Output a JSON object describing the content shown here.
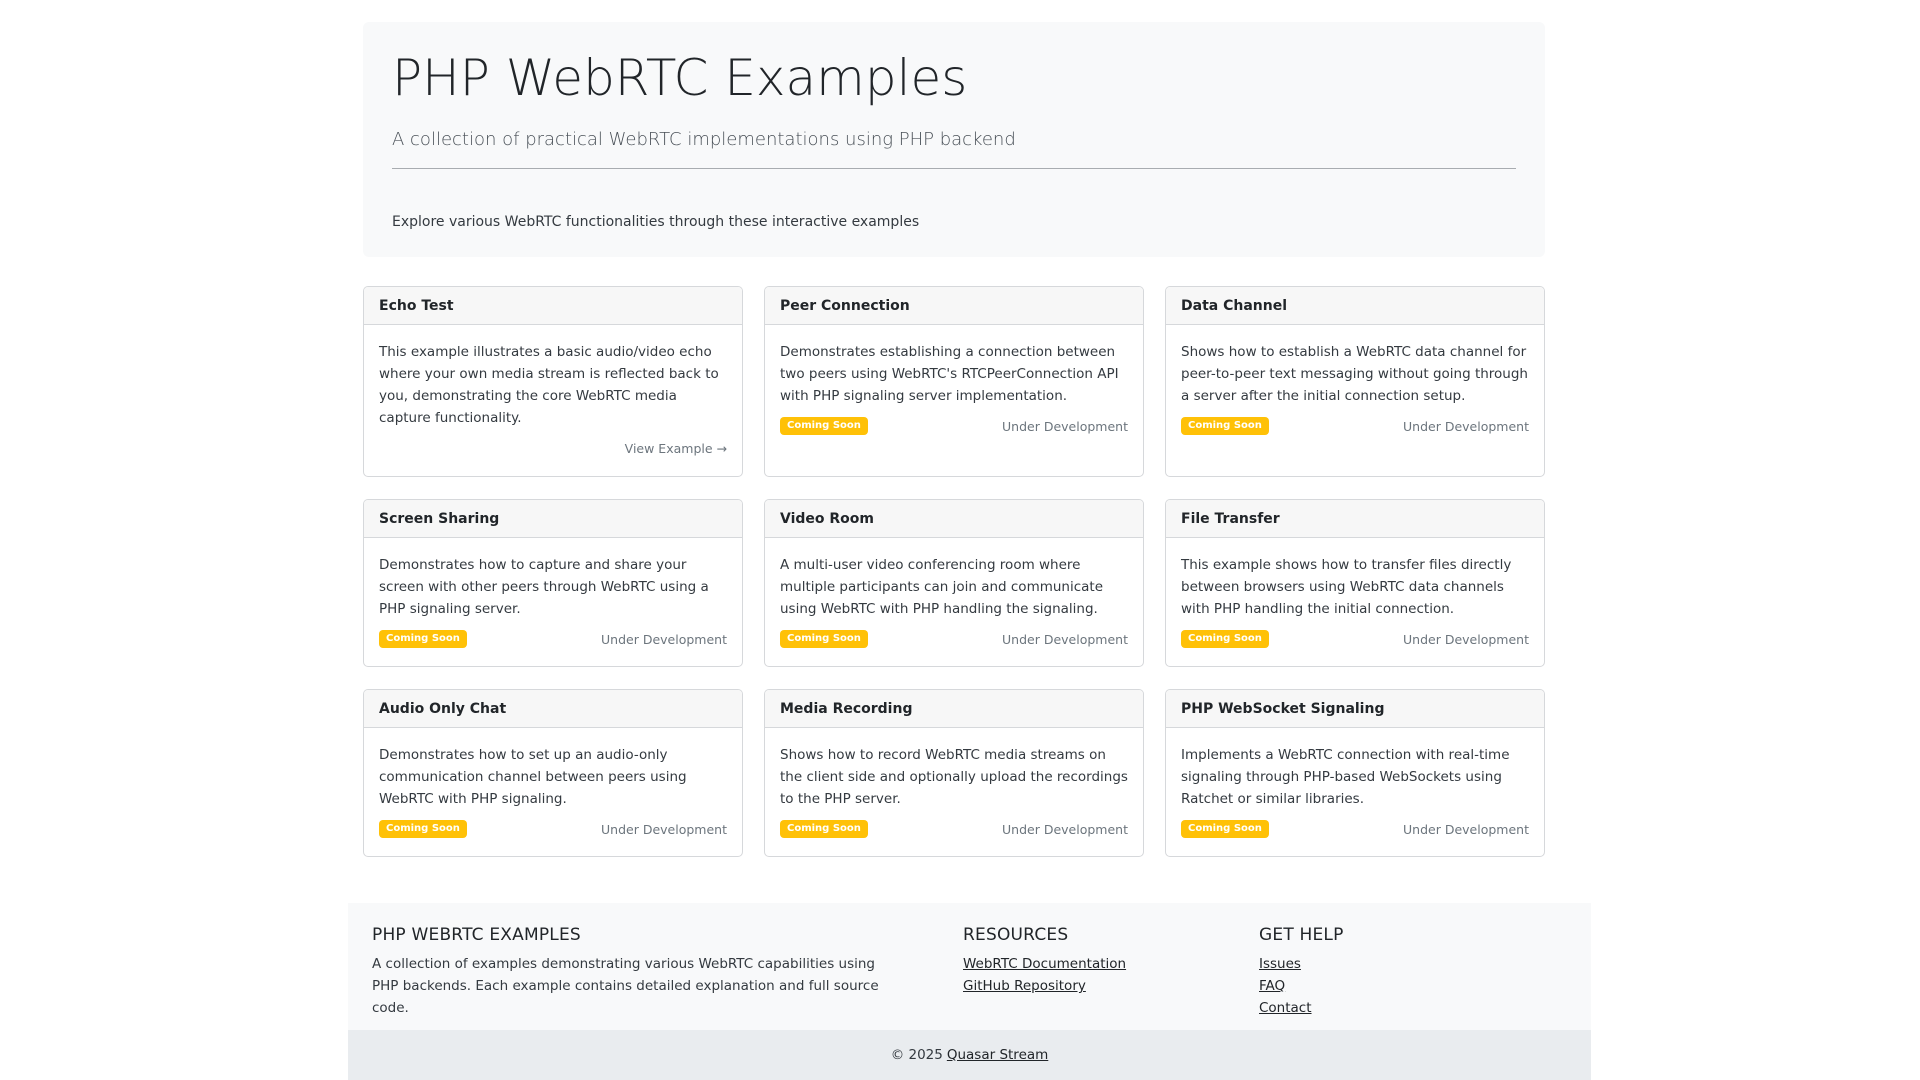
{
  "hero": {
    "title": "PHP WebRTC Examples",
    "lead": "A collection of practical WebRTC implementations using PHP backend",
    "explore": "Explore various WebRTC functionalities through these interactive examples"
  },
  "cards": [
    {
      "title": "Echo Test",
      "text": "This example illustrates a basic audio/video echo where your own media stream is reflected back to you, demonstrating the core WebRTC media capture functionality.",
      "link": "View Example →"
    },
    {
      "title": "Peer Connection",
      "text": "Demonstrates establishing a connection between two peers using WebRTC's RTCPeerConnection API with PHP signaling server implementation.",
      "badge": "Coming Soon",
      "status": "Under Development"
    },
    {
      "title": "Data Channel",
      "text": "Shows how to establish a WebRTC data channel for peer-to-peer text messaging without going through a server after the initial connection setup.",
      "badge": "Coming Soon",
      "status": "Under Development"
    },
    {
      "title": "Screen Sharing",
      "text": "Demonstrates how to capture and share your screen with other peers through WebRTC using a PHP signaling server.",
      "badge": "Coming Soon",
      "status": "Under Development"
    },
    {
      "title": "Video Room",
      "text": "A multi-user video conferencing room where multiple participants can join and communicate using WebRTC with PHP handling the signaling.",
      "badge": "Coming Soon",
      "status": "Under Development"
    },
    {
      "title": "File Transfer",
      "text": "This example shows how to transfer files directly between browsers using WebRTC data channels with PHP handling the initial connection.",
      "badge": "Coming Soon",
      "status": "Under Development"
    },
    {
      "title": "Audio Only Chat",
      "text": "Demonstrates how to set up an audio-only communication channel between peers using WebRTC with PHP signaling.",
      "badge": "Coming Soon",
      "status": "Under Development"
    },
    {
      "title": "Media Recording",
      "text": "Shows how to record WebRTC media streams on the client side and optionally upload the recordings to the PHP server.",
      "badge": "Coming Soon",
      "status": "Under Development"
    },
    {
      "title": "PHP WebSocket Signaling",
      "text": "Implements a WebRTC connection with real-time signaling through PHP-based WebSockets using Ratchet or similar libraries.",
      "badge": "Coming Soon",
      "status": "Under Development"
    }
  ],
  "footer": {
    "about": {
      "heading": "PHP WEBRTC EXAMPLES",
      "text": "A collection of examples demonstrating various WebRTC capabilities using PHP backends. Each example contains detailed explanation and full source code."
    },
    "resources": {
      "heading": "RESOURCES",
      "links": [
        "WebRTC Documentation",
        "GitHub Repository"
      ]
    },
    "help": {
      "heading": "GET HELP",
      "links": [
        "Issues",
        "FAQ",
        "Contact"
      ]
    },
    "copyright_prefix": "© 2025",
    "copyright_link": "Quasar Stream"
  },
  "colors": {
    "badge": "#ffc107",
    "hero_bg": "#f8f9fa",
    "copyright_bg": "#e9ecef"
  }
}
